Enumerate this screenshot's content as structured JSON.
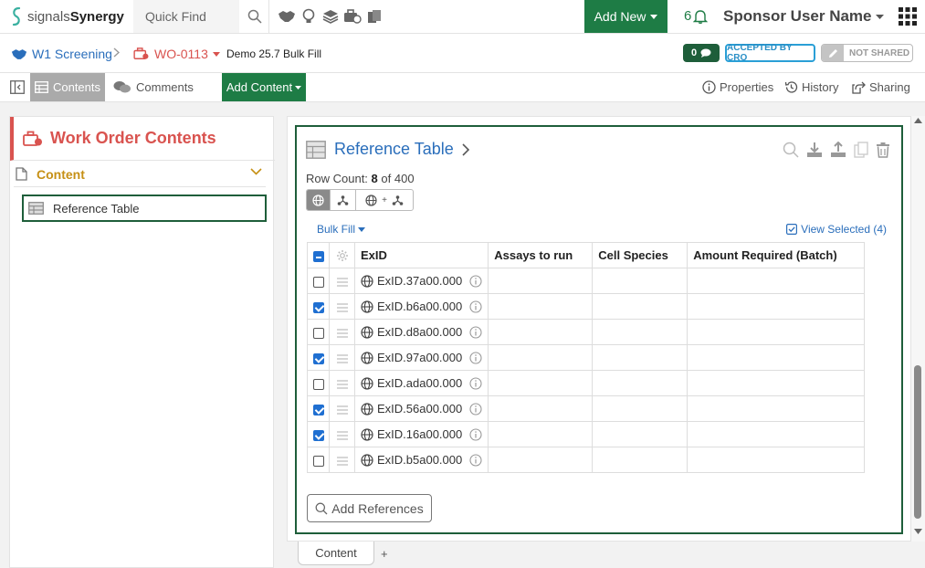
{
  "topbar": {
    "logo_light": "signals",
    "logo_bold": "Synergy",
    "quick_find": "Quick Find",
    "add_new": "Add New",
    "notification_count": "6",
    "user_name": "Sponsor User Name"
  },
  "breadcrumb": {
    "project": "W1 Screening",
    "work_order": "WO-0113",
    "name": "Demo 25.7 Bulk Fill",
    "chat_count": "0",
    "status": "ACCEPTED BY CRO",
    "sharing_status": "NOT SHARED"
  },
  "toolbar": {
    "contents": "Contents",
    "comments": "Comments",
    "add_content": "Add Content",
    "properties": "Properties",
    "history": "History",
    "sharing": "Sharing"
  },
  "left_panel": {
    "title": "Work Order Contents",
    "section": "Content",
    "item": "Reference Table"
  },
  "card": {
    "title": "Reference Table",
    "row_count_label": "Row Count:",
    "row_count": "8",
    "row_count_of": "of 400",
    "mode_plus": "+",
    "bulk_fill": "Bulk Fill",
    "view_selected": "View Selected (4)",
    "add_references": "Add References"
  },
  "table": {
    "columns": [
      "ExID",
      "Assays to run",
      "Cell Species",
      "Amount Required (Batch)"
    ],
    "rows": [
      {
        "exid": "ExID.37a00.000",
        "checked": false
      },
      {
        "exid": "ExID.b6a00.000",
        "checked": true
      },
      {
        "exid": "ExID.d8a00.000",
        "checked": false
      },
      {
        "exid": "ExID.97a00.000",
        "checked": true
      },
      {
        "exid": "ExID.ada00.000",
        "checked": false
      },
      {
        "exid": "ExID.56a00.000",
        "checked": true
      },
      {
        "exid": "ExID.16a00.000",
        "checked": true
      },
      {
        "exid": "ExID.b5a00.000",
        "checked": false
      }
    ]
  },
  "bottom_tabs": {
    "content": "Content",
    "add": "+"
  },
  "colors": {
    "brand_green": "#1e7c45",
    "dark_green": "#1e5e3a",
    "link_blue": "#2a6ebb",
    "work_order_red": "#d9534f",
    "content_gold": "#c69015"
  }
}
